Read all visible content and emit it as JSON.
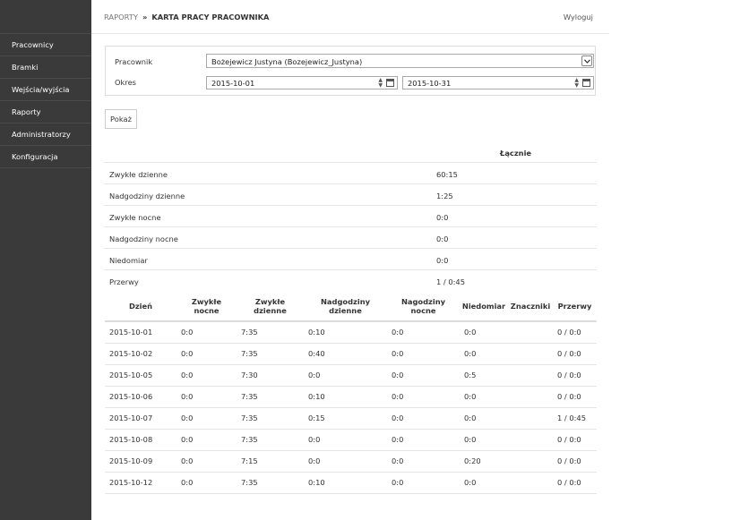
{
  "sidebar": {
    "items": [
      {
        "label": "Pracownicy"
      },
      {
        "label": "Bramki"
      },
      {
        "label": "Wejścia/wyjścia"
      },
      {
        "label": "Raporty"
      },
      {
        "label": "Administratorzy"
      },
      {
        "label": "Konfiguracja"
      }
    ]
  },
  "header": {
    "breadcrumb_root": "RAPORTY",
    "breadcrumb_sep": "»",
    "breadcrumb_current": "KARTA PRACY PRACOWNIKA",
    "logout_label": "Wyloguj"
  },
  "filter": {
    "employee_label": "Pracownik",
    "employee_value": "Bożejewicz Justyna (Bozejewicz_Justyna)",
    "period_label": "Okres",
    "date_from": "2015-10-01",
    "date_to": "2015-10-31",
    "show_button": "Pokaż"
  },
  "summary": {
    "total_header": "Łącznie",
    "rows": [
      {
        "label": "Zwykłe dzienne",
        "value": "60:15"
      },
      {
        "label": "Nadgodziny dzienne",
        "value": "1:25"
      },
      {
        "label": "Zwykłe nocne",
        "value": "0:0"
      },
      {
        "label": "Nadgodziny nocne",
        "value": "0:0"
      },
      {
        "label": "Niedomiar",
        "value": "0:0"
      },
      {
        "label": "Przerwy",
        "value": "1 / 0:45"
      }
    ]
  },
  "days": {
    "columns": [
      {
        "line1": "Dzień",
        "line2": ""
      },
      {
        "line1": "Zwykłe",
        "line2": "nocne"
      },
      {
        "line1": "Zwykłe",
        "line2": "dzienne"
      },
      {
        "line1": "Nadgodziny",
        "line2": "dzienne"
      },
      {
        "line1": "Nagodziny",
        "line2": "nocne"
      },
      {
        "line1": "Niedomiar",
        "line2": ""
      },
      {
        "line1": "Znaczniki",
        "line2": ""
      },
      {
        "line1": "Przerwy",
        "line2": ""
      }
    ],
    "rows": [
      [
        "2015-10-01",
        "0:0",
        "7:35",
        "0:10",
        "0:0",
        "0:0",
        "",
        "0 / 0:0"
      ],
      [
        "2015-10-02",
        "0:0",
        "7:35",
        "0:40",
        "0:0",
        "0:0",
        "",
        "0 / 0:0"
      ],
      [
        "2015-10-05",
        "0:0",
        "7:30",
        "0:0",
        "0:0",
        "0:5",
        "",
        "0 / 0:0"
      ],
      [
        "2015-10-06",
        "0:0",
        "7:35",
        "0:10",
        "0:0",
        "0:0",
        "",
        "0 / 0:0"
      ],
      [
        "2015-10-07",
        "0:0",
        "7:35",
        "0:15",
        "0:0",
        "0:0",
        "",
        "1 / 0:45"
      ],
      [
        "2015-10-08",
        "0:0",
        "7:35",
        "0:0",
        "0:0",
        "0:0",
        "",
        "0 / 0:0"
      ],
      [
        "2015-10-09",
        "0:0",
        "7:15",
        "0:0",
        "0:0",
        "0:20",
        "",
        "0 / 0:0"
      ],
      [
        "2015-10-12",
        "0:0",
        "7:35",
        "0:10",
        "0:0",
        "0:0",
        "",
        "0 / 0:0"
      ]
    ]
  }
}
